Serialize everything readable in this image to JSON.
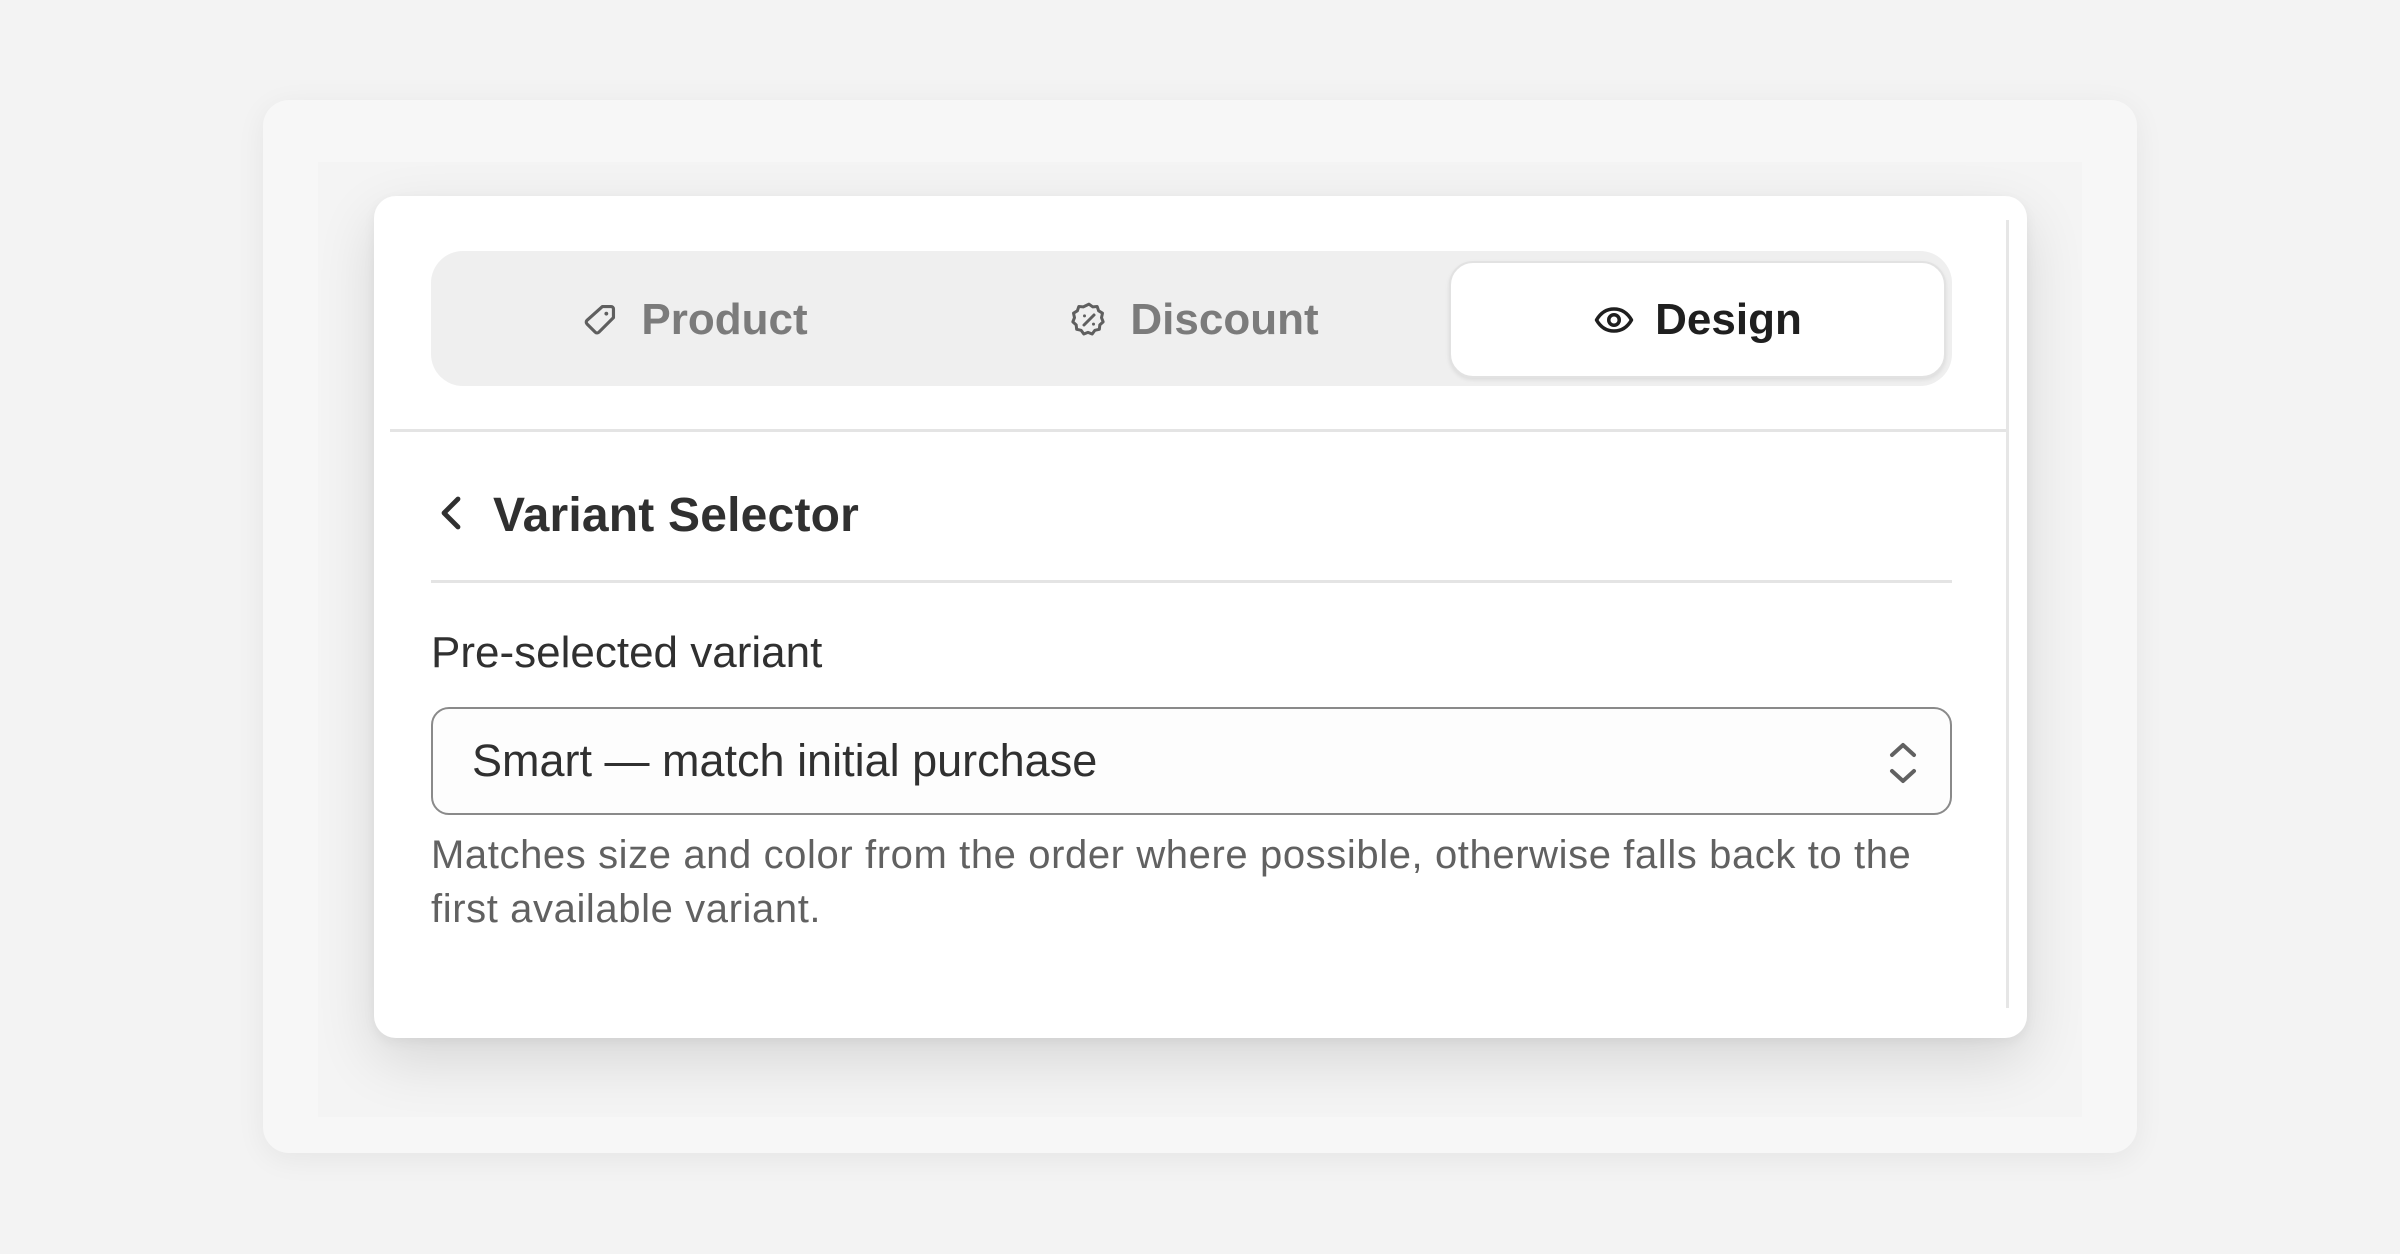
{
  "tabs": [
    {
      "label": "Product",
      "icon": "tag-icon",
      "selected": false
    },
    {
      "label": "Discount",
      "icon": "discount-badge-icon",
      "selected": false
    },
    {
      "label": "Design",
      "icon": "eye-icon",
      "selected": true
    }
  ],
  "section": {
    "title": "Variant Selector",
    "back_icon": "chevron-left-icon"
  },
  "field": {
    "label": "Pre-selected variant",
    "value": "Smart — match initial purchase",
    "help_text": "Matches size and color from the order where possible, otherwise falls back to the first available variant.",
    "select_icon": "select-arrows-icon"
  }
}
